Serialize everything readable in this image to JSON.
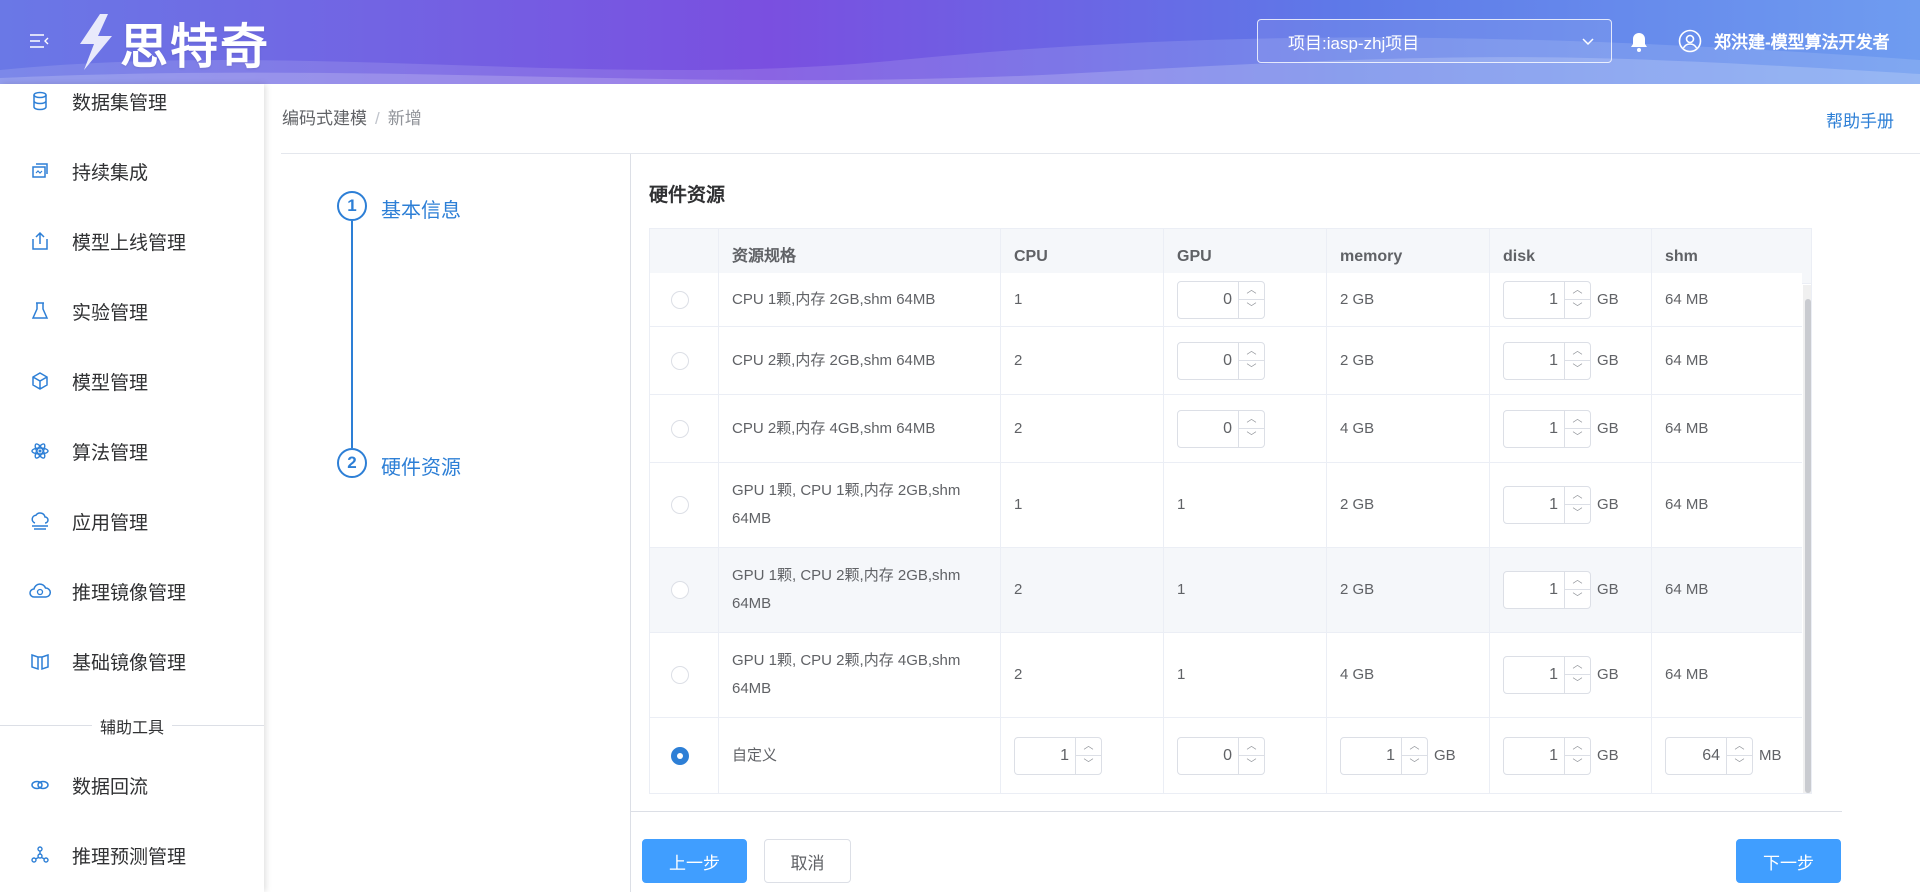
{
  "header": {
    "logo_text": "思特奇",
    "project_label": "项目:iasp-zhj项目",
    "user_name": "郑洪建-模型算法开发者"
  },
  "sidebar": {
    "items": [
      {
        "label": "数据集管理",
        "icon": "database-icon"
      },
      {
        "label": "持续集成",
        "icon": "integration-icon"
      },
      {
        "label": "模型上线管理",
        "icon": "upload-icon"
      },
      {
        "label": "实验管理",
        "icon": "flask-icon"
      },
      {
        "label": "模型管理",
        "icon": "cube-icon"
      },
      {
        "label": "算法管理",
        "icon": "atom-icon"
      },
      {
        "label": "应用管理",
        "icon": "cloud-app-icon"
      },
      {
        "label": "推理镜像管理",
        "icon": "cloud-image-icon"
      },
      {
        "label": "基础镜像管理",
        "icon": "book-icon"
      }
    ],
    "divider_label": "辅助工具",
    "tool_items": [
      {
        "label": "数据回流",
        "icon": "link-icon"
      },
      {
        "label": "推理预测管理",
        "icon": "network-icon"
      }
    ]
  },
  "breadcrumb": {
    "parent": "编码式建模",
    "separator": "/",
    "current": "新增"
  },
  "help_link": "帮助手册",
  "steps": [
    {
      "number": "1",
      "label": "基本信息"
    },
    {
      "number": "2",
      "label": "硬件资源"
    }
  ],
  "section_title": "硬件资源",
  "table": {
    "headers": [
      "资源规格",
      "CPU",
      "GPU",
      "memory",
      "disk",
      "shm"
    ],
    "rows": [
      {
        "spec": "CPU 1颗,内存 2GB,shm 64MB",
        "cpu": "1",
        "gpu": "0",
        "memory": "2 GB",
        "disk": "1",
        "disk_unit": "GB",
        "shm": "64 MB"
      },
      {
        "spec": "CPU 2颗,内存 2GB,shm 64MB",
        "cpu": "2",
        "gpu": "0",
        "memory": "2 GB",
        "disk": "1",
        "disk_unit": "GB",
        "shm": "64 MB"
      },
      {
        "spec": "CPU 2颗,内存 4GB,shm 64MB",
        "cpu": "2",
        "gpu": "0",
        "memory": "4 GB",
        "disk": "1",
        "disk_unit": "GB",
        "shm": "64 MB"
      },
      {
        "spec": "GPU 1颗, CPU 1颗,内存 2GB,shm 64MB",
        "cpu": "1",
        "gpu": "1",
        "memory": "2 GB",
        "disk": "1",
        "disk_unit": "GB",
        "shm": "64 MB"
      },
      {
        "spec": "GPU 1颗, CPU 2颗,内存 2GB,shm 64MB",
        "cpu": "2",
        "gpu": "1",
        "memory": "2 GB",
        "disk": "1",
        "disk_unit": "GB",
        "shm": "64 MB"
      },
      {
        "spec": "GPU 1颗, CPU 2颗,内存 4GB,shm 64MB",
        "cpu": "2",
        "gpu": "1",
        "memory": "4 GB",
        "disk": "1",
        "disk_unit": "GB",
        "shm": "64 MB"
      }
    ],
    "custom_row": {
      "spec": "自定义",
      "cpu": "1",
      "gpu": "0",
      "memory": "1",
      "memory_unit": "GB",
      "disk": "1",
      "disk_unit": "GB",
      "shm": "64",
      "shm_unit": "MB"
    }
  },
  "buttons": {
    "prev": "上一步",
    "cancel": "取消",
    "next": "下一步"
  },
  "colors": {
    "primary": "#409eff",
    "link": "#2d7fd6"
  }
}
